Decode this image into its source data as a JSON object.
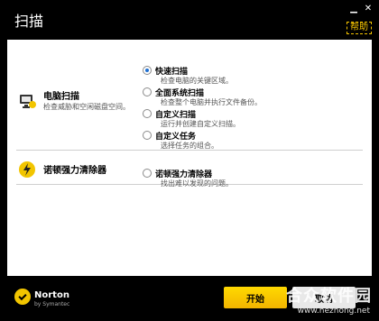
{
  "window": {
    "title": "扫描",
    "close_icon": "close-icon",
    "minimize_icon": "minimize-icon",
    "help_label": "帮助"
  },
  "sections": [
    {
      "title": "电脑扫描",
      "description": "检查威胁和空闲磁盘空间。",
      "icon": "computer-scan-icon"
    },
    {
      "title": "诺顿强力清除器",
      "icon": "power-eraser-icon"
    }
  ],
  "options": [
    {
      "label": "快速扫描",
      "description": "检查电脑的关键区域。",
      "selected": true
    },
    {
      "label": "全面系统扫描",
      "description": "检查整个电脑并执行文件备份。",
      "selected": false
    },
    {
      "label": "自定义扫描",
      "description": "运行并创建自定义扫描。",
      "selected": false
    },
    {
      "label": "自定义任务",
      "description": "选择任务的组合。",
      "selected": false
    },
    {
      "label": "诺顿强力清除器",
      "description": "找出难以发现的问题。",
      "selected": false
    }
  ],
  "footer": {
    "brand": "Norton",
    "brand_sub": "by Symantec",
    "start_label": "开始",
    "cancel_label": "取消",
    "watermark": "合众软件园",
    "watermark_sub": "www.hezhong.net"
  },
  "colors": {
    "accent": "#f2c500",
    "radio_selected": "#1f6fd1"
  }
}
